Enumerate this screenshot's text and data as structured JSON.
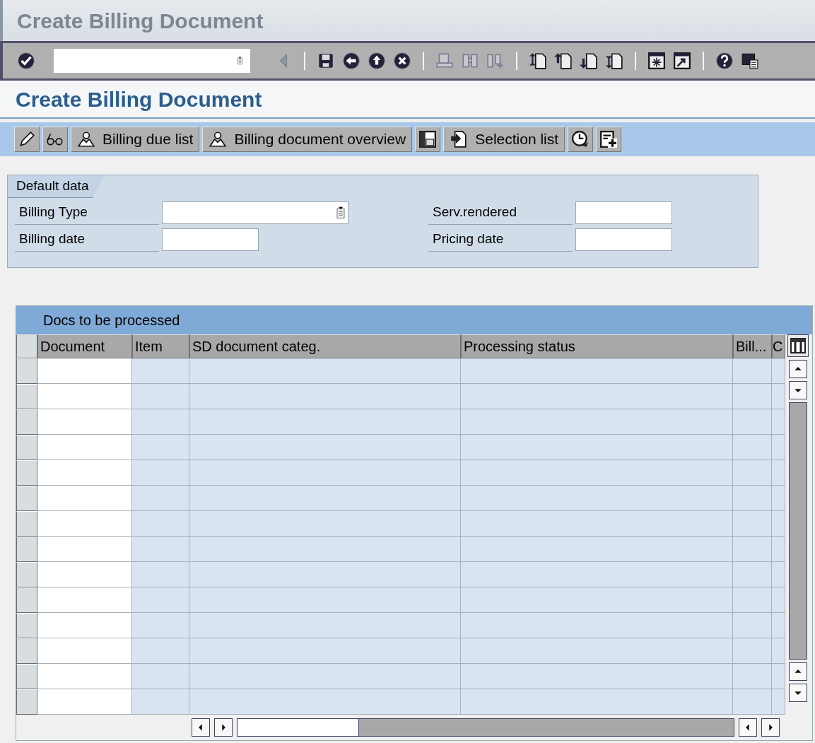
{
  "window": {
    "title": "Create Billing Document"
  },
  "system_toolbar": {
    "buttons": [
      {
        "kind": "enter",
        "disabled": false
      },
      {
        "kind": "back-small",
        "disabled": true
      },
      {
        "kind": "save",
        "disabled": false
      },
      {
        "kind": "back",
        "disabled": false
      },
      {
        "kind": "exit",
        "disabled": false
      },
      {
        "kind": "cancel",
        "disabled": false
      },
      {
        "kind": "print",
        "disabled": true
      },
      {
        "kind": "find",
        "disabled": true
      },
      {
        "kind": "find-next",
        "disabled": true
      },
      {
        "kind": "first",
        "disabled": false
      },
      {
        "kind": "prev",
        "disabled": false
      },
      {
        "kind": "next",
        "disabled": false
      },
      {
        "kind": "last",
        "disabled": false
      },
      {
        "kind": "new-session",
        "disabled": false
      },
      {
        "kind": "shortcut",
        "disabled": false
      },
      {
        "kind": "help",
        "disabled": false
      },
      {
        "kind": "layout",
        "disabled": false
      }
    ]
  },
  "screen_title": "Create Billing Document",
  "app_toolbar": [
    {
      "kind": "edit"
    },
    {
      "kind": "display"
    },
    {
      "kind": "person",
      "label": "Billing due list"
    },
    {
      "kind": "person",
      "label": "Billing document overview"
    },
    {
      "kind": "calendar"
    },
    {
      "kind": "select",
      "label": "Selection list"
    },
    {
      "kind": "clock"
    },
    {
      "kind": "add"
    }
  ],
  "default_data": {
    "title": "Default data",
    "fields": [
      {
        "label": "Billing Type",
        "dropdown": true
      },
      {
        "label": "Serv.rendered",
        "dropdown": false
      },
      {
        "label": "Billing date",
        "dropdown": false
      },
      {
        "label": "Pricing date",
        "dropdown": false
      }
    ]
  },
  "table": {
    "title": "Docs to be processed",
    "columns": [
      "Document",
      "Item",
      "SD document categ.",
      "Processing status",
      "Bill...",
      "C"
    ]
  }
}
